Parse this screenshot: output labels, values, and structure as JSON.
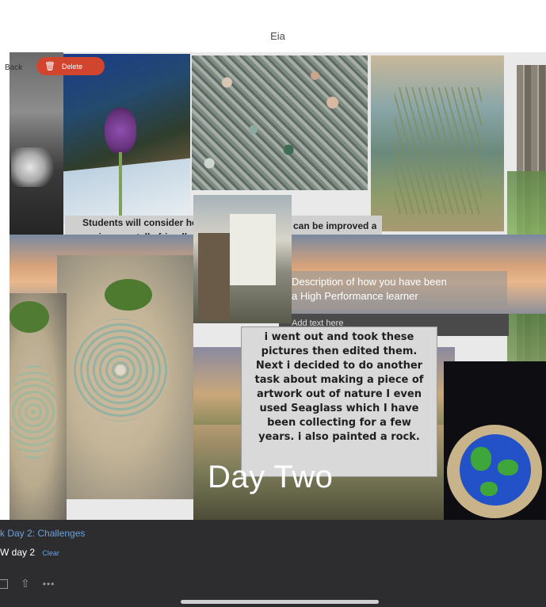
{
  "window": {
    "title": "Eia"
  },
  "toolbar": {
    "back_label": "Back",
    "delete_label": "Delete"
  },
  "board": {
    "caption_env": "Students will consider how their home can be improved and made more environmentally friendly.",
    "caption_env_left": "Students will consider ho",
    "caption_env_right": "can be improved a",
    "caption_env_line2": "environmentally friendly.",
    "desc_line1": "Description of how you have been",
    "desc_line2": "a High Performance learner",
    "add_text_hint": "Add text here",
    "text_box": "i went out and took these pictures then edited them. Next i decided to do another task about making a piece of artwork out of nature I even used Seaglass which I have been collecting for a few years. i also painted a rock.",
    "day_title": "Day Two"
  },
  "bottom": {
    "line1": "k Day 2: Challenges",
    "line2": "W day 2",
    "clear_label": "Clear",
    "more_label": "•••"
  },
  "colors": {
    "accent": "#6aa0e0",
    "delete": "#d1452f",
    "panel": "#2d2d2f"
  }
}
